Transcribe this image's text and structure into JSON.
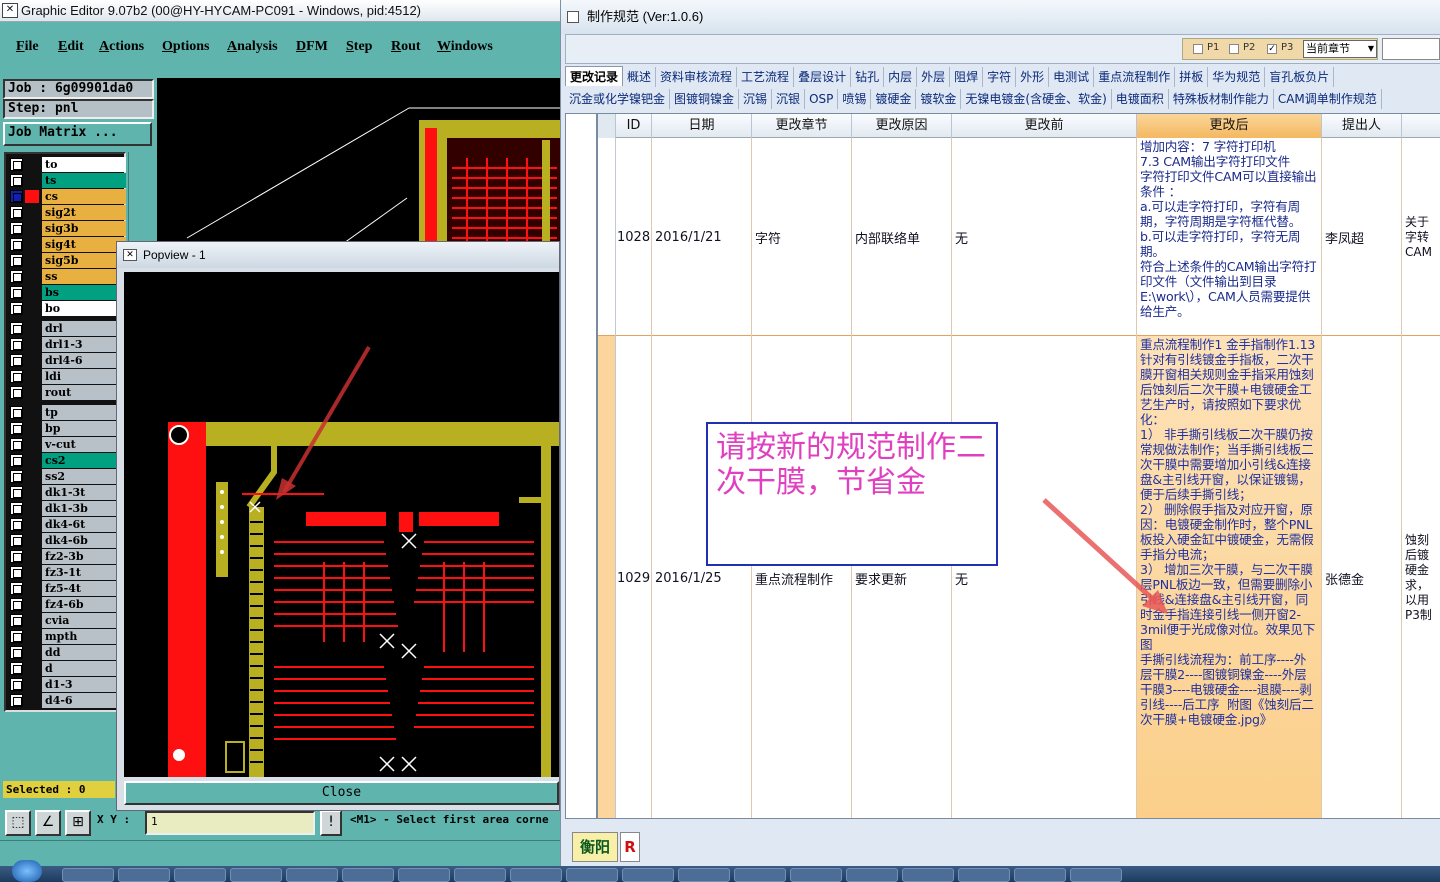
{
  "graphic_editor": {
    "title": "Graphic Editor 9.07b2 (00@HY-HYCAM-PC091 - Windows, pid:4512)",
    "menu": [
      "File",
      "Edit",
      "Actions",
      "Options",
      "Analysis",
      "DFM",
      "Step",
      "Rout",
      "Windows"
    ],
    "job_label": "Job : 6g09901da0",
    "step_label": "Step: pnl",
    "job_matrix_label": "Job Matrix ...",
    "layers": [
      {
        "name": "to",
        "color": "#ffffff",
        "checked": false
      },
      {
        "name": "ts",
        "color": "#00a080",
        "checked": false
      },
      {
        "name": "cs",
        "color": "#e8b040",
        "checked": true
      },
      {
        "name": "sig2t",
        "color": "#e8b040",
        "checked": false
      },
      {
        "name": "sig3b",
        "color": "#e8b040",
        "checked": false
      },
      {
        "name": "sig4t",
        "color": "#e8b040",
        "checked": false
      },
      {
        "name": "sig5b",
        "color": "#e8b040",
        "checked": false
      },
      {
        "name": "ss",
        "color": "#e8b040",
        "checked": false
      },
      {
        "name": "bs",
        "color": "#00a080",
        "checked": false
      },
      {
        "name": "bo",
        "color": "#ffffff",
        "checked": false
      },
      {
        "name": "drl",
        "color": "#b8c0c8",
        "checked": false
      },
      {
        "name": "drl1-3",
        "color": "#b8c0c8",
        "checked": false
      },
      {
        "name": "drl4-6",
        "color": "#b8c0c8",
        "checked": false
      },
      {
        "name": "ldi",
        "color": "#b8c0c8",
        "checked": false
      },
      {
        "name": "rout",
        "color": "#b8c0c8",
        "checked": false
      },
      {
        "name": "tp",
        "color": "#b8c0c8",
        "checked": false
      },
      {
        "name": "bp",
        "color": "#b8c0c8",
        "checked": false
      },
      {
        "name": "v-cut",
        "color": "#b8c0c8",
        "checked": false
      },
      {
        "name": "cs2",
        "color": "#00a080",
        "checked": false
      },
      {
        "name": "ss2",
        "color": "#b8c0c8",
        "checked": false
      },
      {
        "name": "dk1-3t",
        "color": "#b8c0c8",
        "checked": false
      },
      {
        "name": "dk1-3b",
        "color": "#b8c0c8",
        "checked": false
      },
      {
        "name": "dk4-6t",
        "color": "#b8c0c8",
        "checked": false
      },
      {
        "name": "dk4-6b",
        "color": "#b8c0c8",
        "checked": false
      },
      {
        "name": "fz2-3b",
        "color": "#b8c0c8",
        "checked": false
      },
      {
        "name": "fz3-1t",
        "color": "#b8c0c8",
        "checked": false
      },
      {
        "name": "fz5-4t",
        "color": "#b8c0c8",
        "checked": false
      },
      {
        "name": "fz4-6b",
        "color": "#b8c0c8",
        "checked": false
      },
      {
        "name": "cvia",
        "color": "#b8c0c8",
        "checked": false
      },
      {
        "name": "mpth",
        "color": "#b8c0c8",
        "checked": false
      },
      {
        "name": "dd",
        "color": "#b8c0c8",
        "checked": false
      },
      {
        "name": "d",
        "color": "#b8c0c8",
        "checked": false
      },
      {
        "name": "d1-3",
        "color": "#b8c0c8",
        "checked": false
      },
      {
        "name": "d4-6",
        "color": "#b8c0c8",
        "checked": false
      }
    ],
    "selected_label": "Selected : 0",
    "xy_label": "X Y :",
    "coord_value": "1",
    "status_message": "<M1> - Select first area corne"
  },
  "popview": {
    "title": "Popview - 1",
    "close_label": "Close"
  },
  "spec_window": {
    "title": "制作规范 (Ver:1.0.6)",
    "p_options": [
      "P1",
      "P2",
      "P3"
    ],
    "p_checked": [
      false,
      false,
      true
    ],
    "chapter_select": "当前章节",
    "tabs_row1": [
      "更改记录",
      "概述",
      "资料审核流程",
      "工艺流程",
      "叠层设计",
      "钻孔",
      "内层",
      "外层",
      "阻焊",
      "字符",
      "外形",
      "电测试",
      "重点流程制作",
      "拼板",
      "华为规范",
      "盲孔板负片"
    ],
    "tabs_row2": [
      "沉金或化学镍钯金",
      "图镀铜镍金",
      "沉锡",
      "沉银",
      "OSP",
      "喷锡",
      "镀硬金",
      "镀软金",
      "无镍电镀金(含硬金、软金)",
      "电镀面积",
      "特殊板材制作能力",
      "CAM调单制作规范"
    ],
    "columns": [
      "ID",
      "日期",
      "更改章节",
      "更改原因",
      "更改前",
      "更改后",
      "提出人",
      ""
    ],
    "rows": [
      {
        "id": "1028",
        "date": "2016/1/21",
        "chapter": "字符",
        "reason": "内部联络单",
        "before": "无",
        "after": "增加内容：7 字符打印机\n7.3 CAM输出字符打印文件\n字符打印文件CAM可以直接输出条件 ：\na.可以走字符打印，字符有周期，字符周期是字符框代替。\nb.可以走字符打印，字符无周期。\n符合上述条件的CAM输出字符打印文件（文件输出到目录E:\\work\\），CAM人员需要提供给生产。",
        "proposer": "李凤超",
        "extra": "关于字转CAM"
      },
      {
        "id": "1029",
        "date": "2016/1/25",
        "chapter": "重点流程制作",
        "reason": "要求更新",
        "before": "无",
        "after": "重点流程制作1 金手指制作1.13 针对有引线镀金手指板，二次干膜开窗相关规则金手指采用蚀刻后蚀刻后二次干膜+电镀硬金工艺生产时，请按照如下要求优化：\n1） 非手撕引线板二次干膜仍按常规做法制作；当手撕引线板二次干膜中需要增加小引线&连接盘&主引线开窗，以保证镀锡，便于后续手撕引线；\n2） 删除假手指及对应开窗，原因：电镀硬金制作时，整个PNL板投入硬金缸中镀硬金，无需假手指分电流；\n3） 增加三次干膜，与二次干膜层PNL板边一致，但需要删除小引线&连接盘&主引线开窗，同时金手指连接引线一侧开窗2-3mil便于光成像对位。效果见下图\n手撕引线流程为：前工序----外层干膜2----图镀铜镍金----外层干膜3----电镀硬金----退膜----剥引线----后工序  附图《蚀刻后二次干膜+电镀硬金.jpg》",
        "proposer": "张德金",
        "extra": "蚀刻后镀硬金求，以用P3制"
      }
    ],
    "annotation": "请按新的规范制作二次干膜，节省金",
    "footer_buttons": [
      "衡阳",
      "R"
    ]
  },
  "colors": {
    "teal_chrome": "#5fb4ad",
    "pcb_red": "#ff1010",
    "pcb_yellow": "#b8b020",
    "arrow_red": "#e04040",
    "annotation_text": "#e040c0",
    "annotation_border": "#2030b0"
  }
}
